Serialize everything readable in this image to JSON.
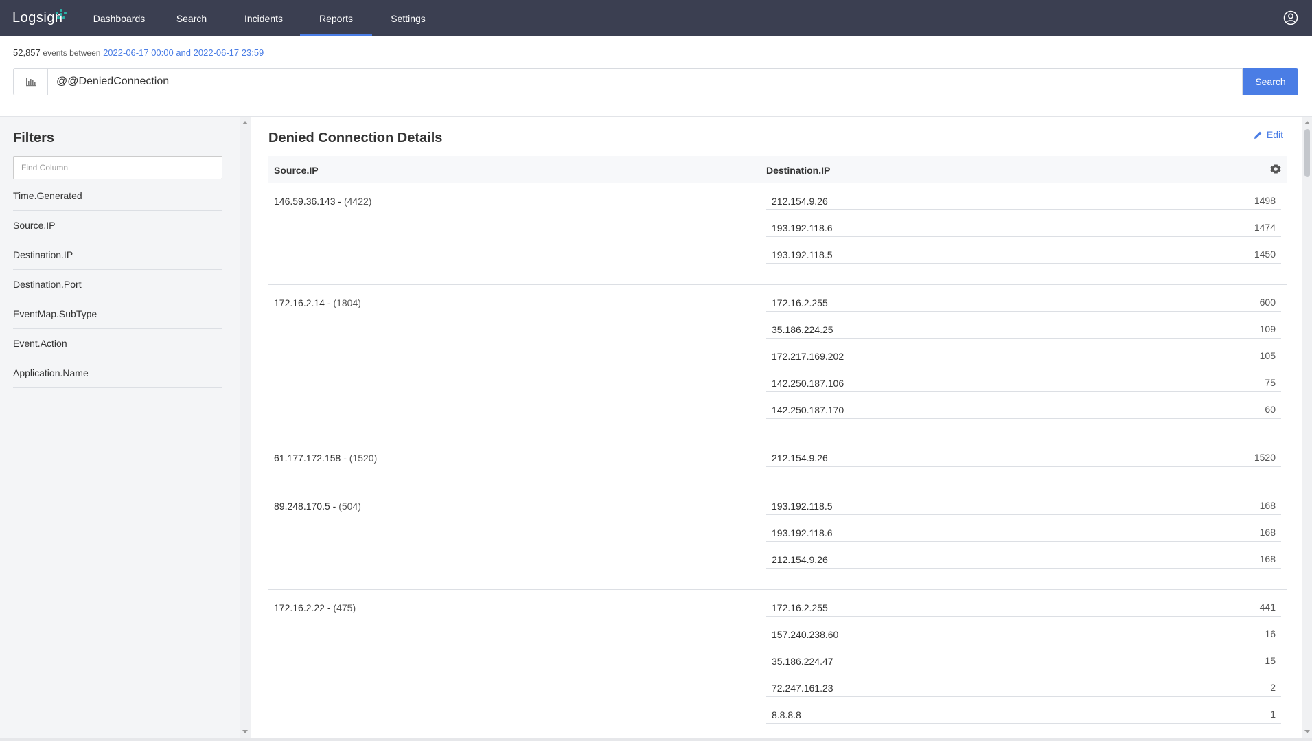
{
  "app": {
    "logo_text": "Logsign"
  },
  "nav": {
    "items": [
      {
        "label": "Dashboards",
        "active": false
      },
      {
        "label": "Search",
        "active": false
      },
      {
        "label": "Incidents",
        "active": false
      },
      {
        "label": "Reports",
        "active": true
      },
      {
        "label": "Settings",
        "active": false
      }
    ]
  },
  "summary": {
    "count": "52,857",
    "events_between": "events between",
    "range": "2022-06-17 00:00 and 2022-06-17 23:59"
  },
  "search": {
    "query": "@@DeniedConnection",
    "button_label": "Search"
  },
  "filters": {
    "title": "Filters",
    "find_placeholder": "Find Column",
    "items": [
      "Time.Generated",
      "Source.IP",
      "Destination.IP",
      "Destination.Port",
      "EventMap.SubType",
      "Event.Action",
      "Application.Name"
    ]
  },
  "report": {
    "title": "Denied Connection Details",
    "edit_label": "Edit",
    "col_source": "Source.IP",
    "col_destination": "Destination.IP",
    "groups": [
      {
        "source": "146.59.36.143",
        "total": "(4422)",
        "destinations": [
          {
            "ip": "212.154.9.26",
            "count": "1498"
          },
          {
            "ip": "193.192.118.6",
            "count": "1474"
          },
          {
            "ip": "193.192.118.5",
            "count": "1450"
          }
        ]
      },
      {
        "source": "172.16.2.14",
        "total": "(1804)",
        "destinations": [
          {
            "ip": "172.16.2.255",
            "count": "600"
          },
          {
            "ip": "35.186.224.25",
            "count": "109"
          },
          {
            "ip": "172.217.169.202",
            "count": "105"
          },
          {
            "ip": "142.250.187.106",
            "count": "75"
          },
          {
            "ip": "142.250.187.170",
            "count": "60"
          }
        ]
      },
      {
        "source": "61.177.172.158",
        "total": "(1520)",
        "destinations": [
          {
            "ip": "212.154.9.26",
            "count": "1520"
          }
        ]
      },
      {
        "source": "89.248.170.5",
        "total": "(504)",
        "destinations": [
          {
            "ip": "193.192.118.5",
            "count": "168"
          },
          {
            "ip": "193.192.118.6",
            "count": "168"
          },
          {
            "ip": "212.154.9.26",
            "count": "168"
          }
        ]
      },
      {
        "source": "172.16.2.22",
        "total": "(475)",
        "destinations": [
          {
            "ip": "172.16.2.255",
            "count": "441"
          },
          {
            "ip": "157.240.238.60",
            "count": "16"
          },
          {
            "ip": "35.186.224.47",
            "count": "15"
          },
          {
            "ip": "72.247.161.23",
            "count": "2"
          },
          {
            "ip": "8.8.8.8",
            "count": "1"
          }
        ]
      }
    ]
  },
  "colors": {
    "navbar": "#3b3f51",
    "accent": "#4a7de5"
  }
}
